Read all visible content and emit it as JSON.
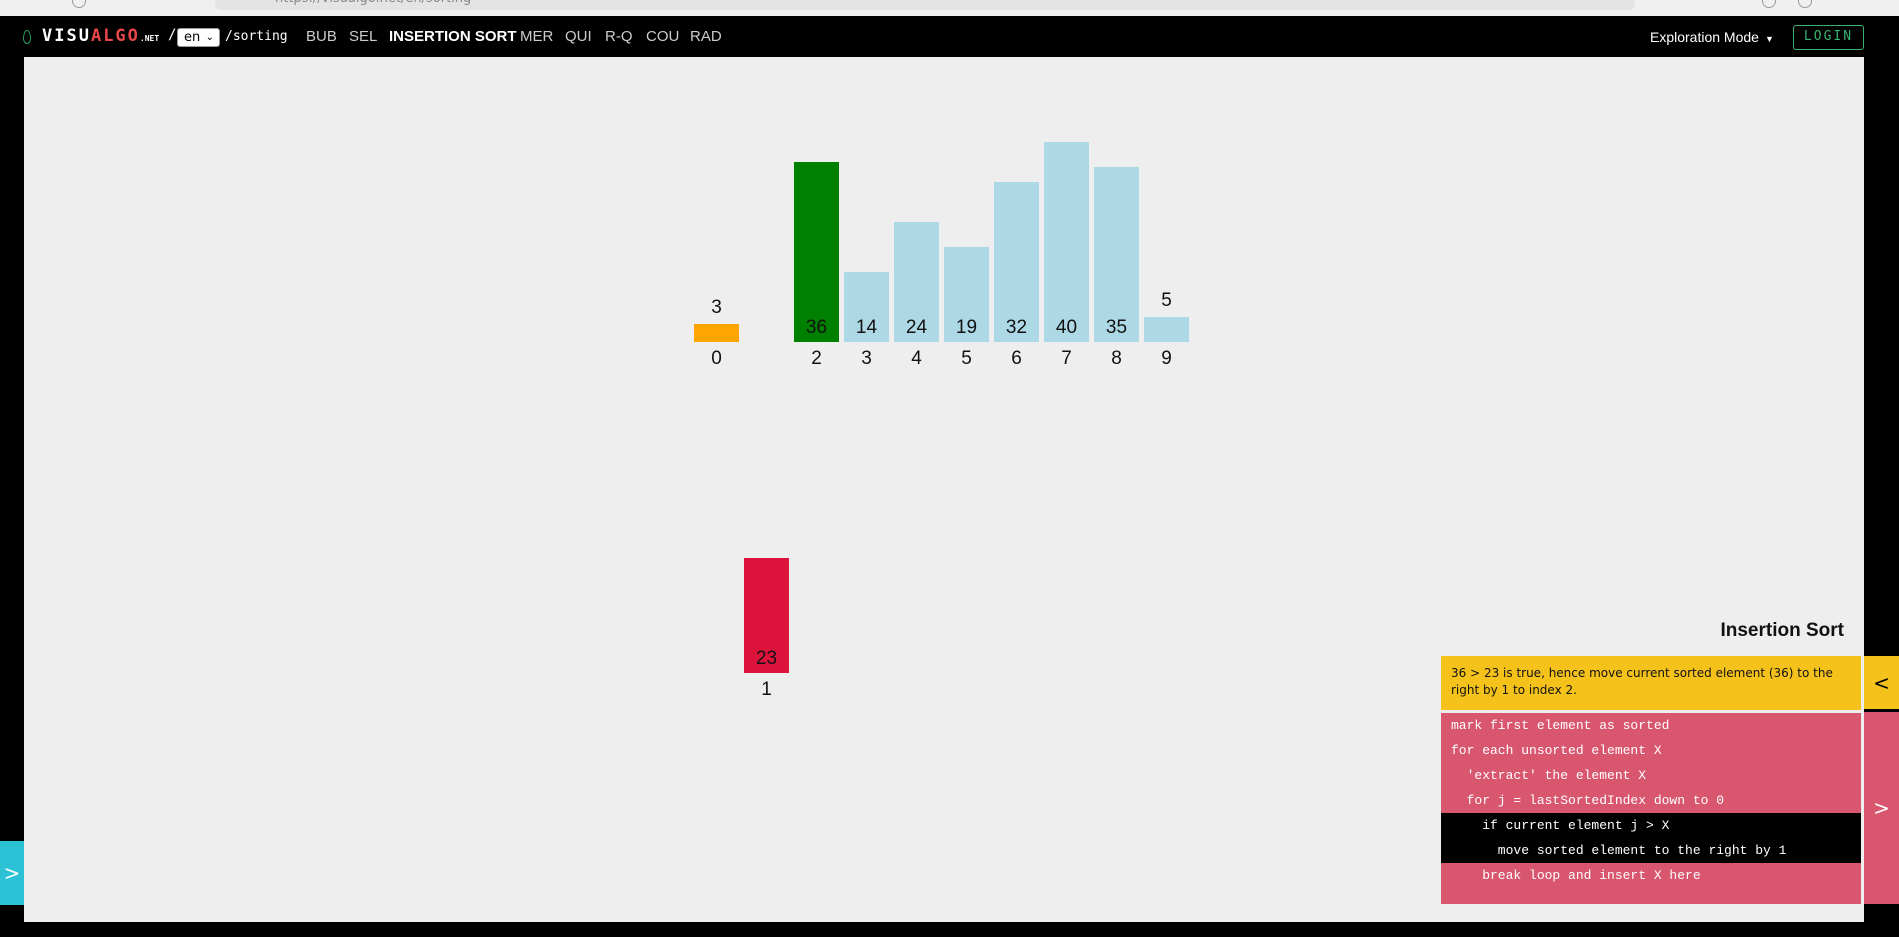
{
  "browser": {
    "url": "https://visualgo.net/en/sorting"
  },
  "header": {
    "logo_main": "VISU",
    "logo_accent": "ALGO",
    "logo_suffix": ".NET",
    "lang": "en",
    "route": "/sorting",
    "menu": [
      {
        "label": "BUB",
        "active": false
      },
      {
        "label": "SEL",
        "active": false
      },
      {
        "label": "INSERTION SORT",
        "active": true
      },
      {
        "label": "MER",
        "active": false
      },
      {
        "label": "QUI",
        "active": false
      },
      {
        "label": "R-Q",
        "active": false
      },
      {
        "label": "COU",
        "active": false
      },
      {
        "label": "RAD",
        "active": false
      }
    ],
    "mode": "Exploration Mode",
    "login": "LOGIN"
  },
  "colors": {
    "sorted": "#008000",
    "unsorted": "#add8e6",
    "current": "#dc143c",
    "compared": "#ffa500",
    "status_bg": "#f5c21b",
    "code_bg": "#d9566f"
  },
  "chart_data": {
    "type": "bar",
    "array": [
      {
        "index": 0,
        "value": 3,
        "state": "compared"
      },
      {
        "index": 2,
        "value": 36,
        "state": "sorted"
      },
      {
        "index": 3,
        "value": 14,
        "state": "unsorted"
      },
      {
        "index": 4,
        "value": 24,
        "state": "unsorted"
      },
      {
        "index": 5,
        "value": 19,
        "state": "unsorted"
      },
      {
        "index": 6,
        "value": 32,
        "state": "unsorted"
      },
      {
        "index": 7,
        "value": 40,
        "state": "unsorted"
      },
      {
        "index": 8,
        "value": 35,
        "state": "unsorted"
      },
      {
        "index": 9,
        "value": 5,
        "state": "unsorted"
      }
    ],
    "extracted": {
      "index": 1,
      "value": 23,
      "state": "current"
    }
  },
  "panel": {
    "title": "Insertion Sort",
    "status": "36 > 23 is true, hence move current sorted element (36) to the right by 1 to index 2.",
    "code": [
      {
        "text": "mark first element as sorted",
        "highlight": false
      },
      {
        "text": "for each unsorted element X",
        "highlight": false
      },
      {
        "text": "  'extract' the element X",
        "highlight": false
      },
      {
        "text": "  for j = lastSortedIndex down to 0",
        "highlight": false
      },
      {
        "text": "    if current element j > X",
        "highlight": true
      },
      {
        "text": "      move sorted element to the right by 1",
        "highlight": true
      },
      {
        "text": "    break loop and insert X here",
        "highlight": false
      }
    ]
  },
  "tabs": {
    "left": ">",
    "right_top": "<",
    "right_bottom": ">"
  }
}
